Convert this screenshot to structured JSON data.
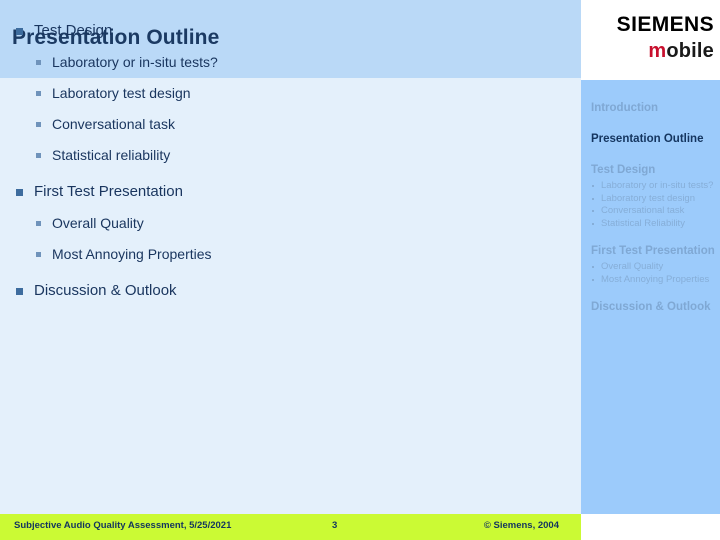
{
  "slide": {
    "title": "Presentation Outline"
  },
  "logo": {
    "brand": "SIEMENS",
    "sub_first_letter": "m",
    "sub_rest": "obile"
  },
  "outline": [
    {
      "level": 1,
      "label": "Test Design"
    },
    {
      "level": 2,
      "label": "Laboratory or in-situ tests?"
    },
    {
      "level": 2,
      "label": "Laboratory test design"
    },
    {
      "level": 2,
      "label": "Conversational task"
    },
    {
      "level": 2,
      "label": "Statistical reliability"
    },
    {
      "level": 1,
      "label": "First Test Presentation"
    },
    {
      "level": 2,
      "label": "Overall Quality"
    },
    {
      "level": 2,
      "label": "Most Annoying Properties"
    },
    {
      "level": 1,
      "label": "Discussion & Outlook"
    }
  ],
  "nav": {
    "sections": [
      {
        "label": "Introduction",
        "active": false,
        "items": []
      },
      {
        "label": "Presentation Outline",
        "active": true,
        "items": []
      },
      {
        "label": "Test Design",
        "active": false,
        "items": [
          "Laboratory or in-situ tests?",
          "Laboratory test design",
          "Conversational task",
          "Statistical Reliability"
        ]
      },
      {
        "label": "First Test Presentation",
        "active": false,
        "items": [
          "Overall Quality",
          "Most Annoying Properties"
        ]
      },
      {
        "label": "Discussion & Outlook",
        "active": false,
        "items": []
      }
    ]
  },
  "footer": {
    "left": "Subjective Audio Quality Assessment, 5/25/2021",
    "page": "3",
    "right": "© Siemens, 2004"
  },
  "colors": {
    "header_band": "#bad9f7",
    "body_background": "#e4f0fb",
    "nav_background": "#9ccbfb",
    "footer_background": "#cbfa34",
    "title_text": "#1b3a63",
    "bullet_level1": "#3d6c9e",
    "bullet_level2": "#6f93bb",
    "nav_inactive": "#7fa8d4",
    "nav_active": "#14355f",
    "logo_accent": "#c8102e"
  }
}
